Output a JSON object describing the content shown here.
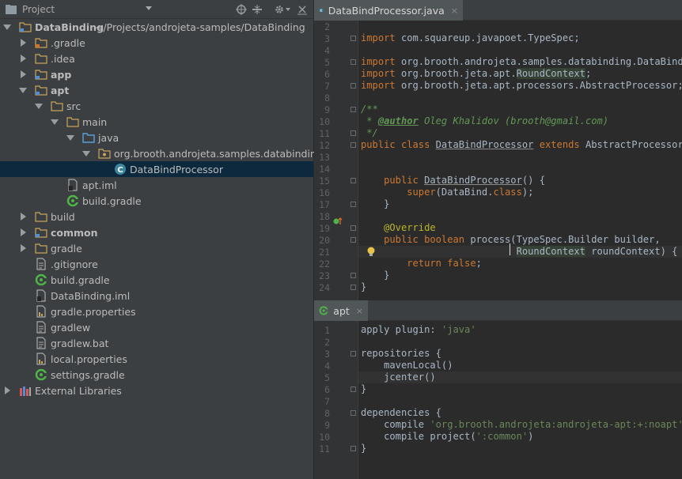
{
  "project_panel": {
    "title": "Project",
    "tree": [
      {
        "label": "DataBinding",
        "path": "~/Projects/androjeta-samples/DataBinding",
        "icon": "module-folder-icon",
        "arrow": "down",
        "bold": true
      },
      {
        "label": ".gradle",
        "icon": "folder-orange-icon",
        "arrow": "right"
      },
      {
        "label": ".idea",
        "icon": "folder-icon",
        "arrow": "right"
      },
      {
        "label": "app",
        "icon": "module-folder-icon",
        "arrow": "right",
        "bold": true
      },
      {
        "label": "apt",
        "icon": "module-folder-icon",
        "arrow": "down",
        "bold": true
      },
      {
        "label": "src",
        "icon": "folder-icon",
        "arrow": "down"
      },
      {
        "label": "main",
        "icon": "folder-icon",
        "arrow": "down"
      },
      {
        "label": "java",
        "icon": "source-folder-icon",
        "arrow": "down"
      },
      {
        "label": "org.brooth.androjeta.samples.databinding.",
        "icon": "package-icon",
        "arrow": "down"
      },
      {
        "label": "DataBindProcessor",
        "icon": "java-class-icon",
        "selected": true
      },
      {
        "label": "apt.iml",
        "icon": "iml-file-icon"
      },
      {
        "label": "build.gradle",
        "icon": "gradle-file-icon"
      },
      {
        "label": "build",
        "icon": "folder-icon",
        "arrow": "right"
      },
      {
        "label": "common",
        "icon": "module-folder-icon",
        "arrow": "right",
        "bold": true
      },
      {
        "label": "gradle",
        "icon": "folder-icon",
        "arrow": "right"
      },
      {
        "label": ".gitignore",
        "icon": "text-file-icon"
      },
      {
        "label": "build.gradle",
        "icon": "gradle-file-icon"
      },
      {
        "label": "DataBinding.iml",
        "icon": "iml-file-icon"
      },
      {
        "label": "gradle.properties",
        "icon": "properties-file-icon"
      },
      {
        "label": "gradlew",
        "icon": "text-file-icon"
      },
      {
        "label": "gradlew.bat",
        "icon": "text-file-icon"
      },
      {
        "label": "local.properties",
        "icon": "properties-file-icon"
      },
      {
        "label": "settings.gradle",
        "icon": "gradle-file-icon"
      },
      {
        "label": "External Libraries",
        "icon": "libraries-icon",
        "arrow": "right"
      }
    ]
  },
  "editor_java": {
    "tab_label": "DataBindProcessor.java",
    "tab_close": "×",
    "lines": [
      {
        "n": "2",
        "html": ""
      },
      {
        "n": "3",
        "html": "<span class='k'>import</span> com.squareup.javapoet.TypeSpec;"
      },
      {
        "n": "4",
        "html": ""
      },
      {
        "n": "5",
        "html": "<span class='k'>import</span> org.brooth.androjeta.samples.databinding.DataBind;"
      },
      {
        "n": "6",
        "html": "<span class='k'>import</span> org.brooth.jeta.apt.<span class='ref'>RoundContext</span>;"
      },
      {
        "n": "7",
        "html": "<span class='k'>import</span> org.brooth.jeta.apt.processors.AbstractProcessor;"
      },
      {
        "n": "8",
        "html": ""
      },
      {
        "n": "9",
        "html": "<span class='c'>/**</span>"
      },
      {
        "n": "10",
        "html": "<span class='c'> * </span><span class='ct'>@author</span><span class='c'> Oleg Khalidov (brooth@gmail.com)</span>"
      },
      {
        "n": "11",
        "html": "<span class='c'> */</span>"
      },
      {
        "n": "12",
        "html": "<span class='k'>public class</span> <span class='uline'>DataBindProcessor</span> <span class='k'>extends</span> AbstractProcessor {"
      },
      {
        "n": "13",
        "html": ""
      },
      {
        "n": "14",
        "html": ""
      },
      {
        "n": "15",
        "html": "    <span class='k'>public</span> <span class='uline'>DataBindProcessor</span>() {"
      },
      {
        "n": "16",
        "html": "        <span class='k'>super</span>(DataBind.<span class='k'>class</span>);"
      },
      {
        "n": "17",
        "html": "    }"
      },
      {
        "n": "18",
        "html": ""
      },
      {
        "n": "19",
        "html": "    <span class='a'>@Override</span>"
      },
      {
        "n": "20",
        "html": "    <span class='k'>public boolean</span> process(TypeSpec.Builder builder,"
      },
      {
        "n": "21",
        "html": "                           <span class='ref'>RoundContext</span> roundContext) {"
      },
      {
        "n": "22",
        "html": "        <span class='k'>return false</span>;"
      },
      {
        "n": "23",
        "html": "    }"
      },
      {
        "n": "24",
        "html": "}"
      }
    ]
  },
  "editor_gradle": {
    "tab_label": "apt",
    "tab_close": "×",
    "lines": [
      {
        "n": "1",
        "html": "apply plugin: <span class='s'>'java'</span>"
      },
      {
        "n": "2",
        "html": ""
      },
      {
        "n": "3",
        "html": "repositories {"
      },
      {
        "n": "4",
        "html": "    mavenLocal()"
      },
      {
        "n": "5",
        "html": "    jcenter()"
      },
      {
        "n": "6",
        "html": "}"
      },
      {
        "n": "7",
        "html": ""
      },
      {
        "n": "8",
        "html": "dependencies {"
      },
      {
        "n": "9",
        "html": "    compile <span class='s'>'org.brooth.androjeta:androjeta-apt:+:noapt'</span>"
      },
      {
        "n": "10",
        "html": "    compile project(<span class='s'>':common'</span>)"
      },
      {
        "n": "11",
        "html": "}"
      }
    ]
  },
  "colors": {
    "panel_bg": "#3c3f41",
    "editor_bg": "#2b2b2b",
    "selection": "#0d293e",
    "keyword": "#cc7832",
    "comment": "#629755",
    "string": "#6a8759",
    "annotation": "#bbb529"
  }
}
